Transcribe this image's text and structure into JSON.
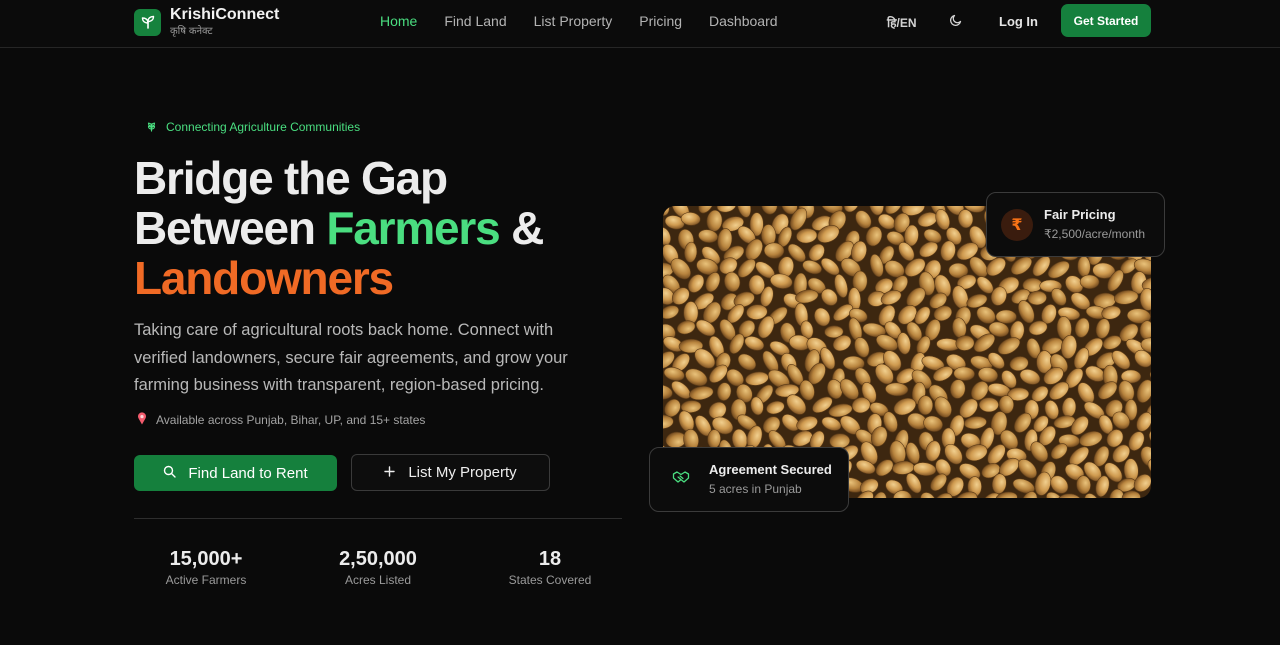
{
  "nav": {
    "brand_name": "KrishiConnect",
    "brand_sub": "कृषि कनेक्ट",
    "links": [
      "Home",
      "Find Land",
      "List Property",
      "Pricing",
      "Dashboard"
    ],
    "lang": "हि/EN",
    "login": "Log In",
    "cta": "Get Started"
  },
  "hero": {
    "badge": "Connecting Agriculture Communities",
    "headline": {
      "line1": "Bridge the Gap",
      "line2_pre": "Between ",
      "line2_green": "Farmers",
      "line2_post": " &",
      "line3": "Landowners"
    },
    "description": "Taking care of agricultural roots back home. Connect with verified landowners, secure fair agreements, and grow your farming business with transparent, region-based pricing.",
    "availability": "Available across Punjab, Bihar, UP, and 15+ states",
    "primary_button": "Find Land to Rent",
    "secondary_button": "List My Property",
    "stats": [
      {
        "value": "15,000+",
        "label": "Active Farmers"
      },
      {
        "value": "2,50,000",
        "label": "Acres Listed"
      },
      {
        "value": "18",
        "label": "States Covered"
      }
    ]
  },
  "cards": {
    "pricing": {
      "icon": "rupee-icon",
      "symbol": "₹",
      "title": "Fair Pricing",
      "subtitle": "₹2,500/acre/month"
    },
    "agreement": {
      "icon": "handshake-icon",
      "title": "Agreement Secured",
      "subtitle": "5 acres in Punjab"
    }
  },
  "colors": {
    "accent_green": "#4ade80",
    "button_green": "#15803d",
    "accent_orange": "#f06a25",
    "background": "#0a0a0a"
  }
}
